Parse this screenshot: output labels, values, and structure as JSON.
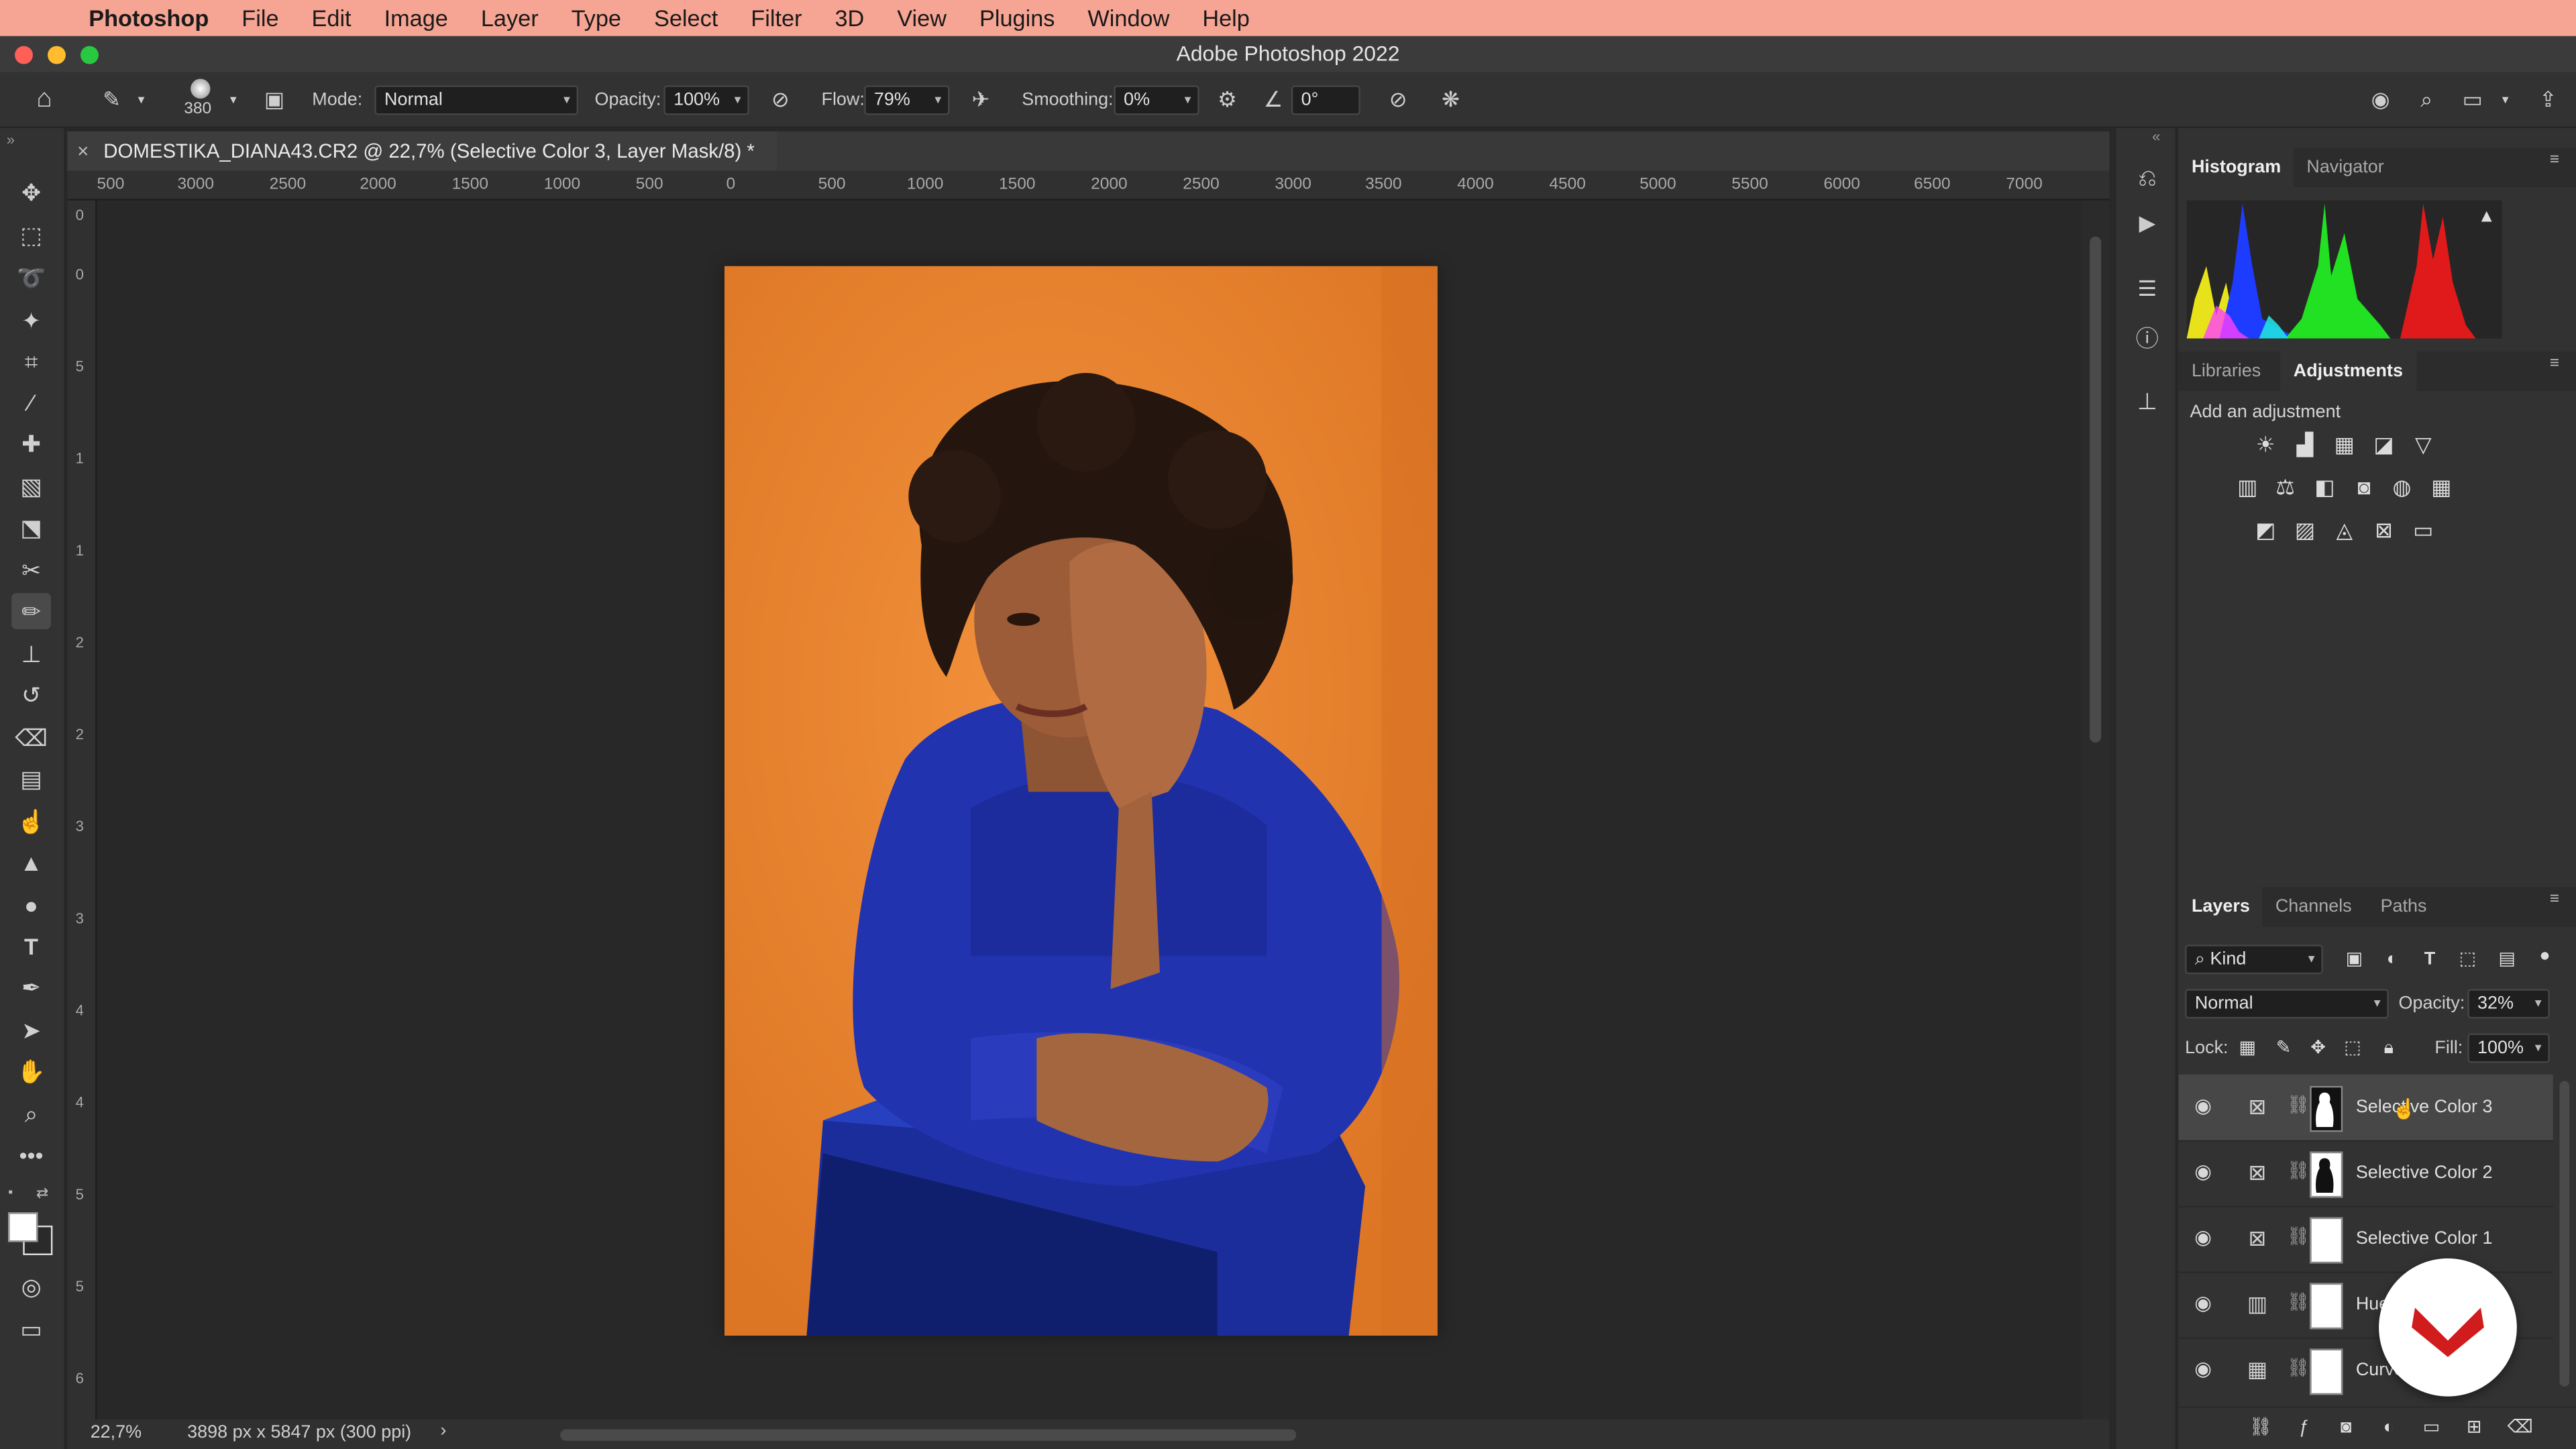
{
  "menubar": {
    "apple_icon": "apple-icon",
    "app_name": "Photoshop",
    "items": [
      "File",
      "Edit",
      "Image",
      "Layer",
      "Type",
      "Select",
      "Filter",
      "3D",
      "View",
      "Plugins",
      "Window",
      "Help"
    ]
  },
  "window": {
    "title": "Adobe Photoshop 2022"
  },
  "options": {
    "brush_size": "380",
    "mode_label": "Mode:",
    "mode_value": "Normal",
    "opacity_label": "Opacity:",
    "opacity_value": "100%",
    "flow_label": "Flow:",
    "flow_value": "79%",
    "smoothing_label": "Smoothing:",
    "smoothing_value": "0%",
    "angle_value": "0°"
  },
  "document": {
    "tab_title": "DOMESTIKA_DIANA43.CR2 @ 22,7% (Selective Color 3, Layer Mask/8) *",
    "close_glyph": "×",
    "ruler_h": [
      "500",
      "3000",
      "2500",
      "2000",
      "1500",
      "1000",
      "500",
      "0",
      "500",
      "1000",
      "1500",
      "2000",
      "2500",
      "3000",
      "3500",
      "4000",
      "4500",
      "5000",
      "5500",
      "6000",
      "6500",
      "7000"
    ],
    "ruler_v": [
      "0",
      "0",
      "5",
      "1",
      "1",
      "2",
      "2",
      "3",
      "3",
      "4",
      "4",
      "5",
      "5",
      "6"
    ],
    "zoom": "22,7%",
    "dimensions": "3898 px x 5847 px (300 ppi)",
    "status_arrow": "›"
  },
  "panels": {
    "histogram_tab": "Histogram",
    "navigator_tab": "Navigator",
    "libraries_tab": "Libraries",
    "adjustments_tab": "Adjustments",
    "add_adjustment": "Add an adjustment",
    "layers_tab": "Layers",
    "channels_tab": "Channels",
    "paths_tab": "Paths",
    "kind_filter": "Kind",
    "blend_mode": "Normal",
    "opacity_label": "Opacity:",
    "opacity_value": "32%",
    "lock_label": "Lock:",
    "fill_label": "Fill:",
    "fill_value": "100%"
  },
  "layers": [
    {
      "name": "Selective Color 3",
      "selected": true
    },
    {
      "name": "Selective Color 2",
      "selected": false
    },
    {
      "name": "Selective Color 1",
      "selected": false
    },
    {
      "name": "Hue",
      "selected": false
    },
    {
      "name": "Curve",
      "selected": false
    }
  ],
  "colors": {
    "menubar": "#f6a493",
    "backdrop": "#e9842c",
    "sweater": "#1f2fa4",
    "logo": "#d01c1c"
  }
}
